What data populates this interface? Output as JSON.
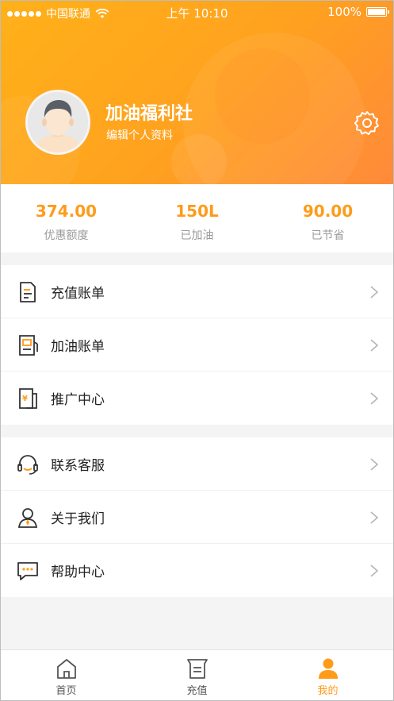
{
  "status_bar": {
    "carrier": "中国联通",
    "time": "上午 10:10",
    "battery": "100%"
  },
  "profile": {
    "name": "加油福利社",
    "edit_label": "编辑个人资料"
  },
  "stats": [
    {
      "value": "374.00",
      "label": "优惠额度"
    },
    {
      "value": "150L",
      "label": "已加油"
    },
    {
      "value": "90.00",
      "label": "已节省"
    }
  ],
  "menu": {
    "group1": [
      {
        "label": "充值账单",
        "icon": "recharge-bill-icon"
      },
      {
        "label": "加油账单",
        "icon": "fuel-bill-icon"
      },
      {
        "label": "推广中心",
        "icon": "promotion-icon"
      }
    ],
    "group2": [
      {
        "label": "联系客服",
        "icon": "headset-icon"
      },
      {
        "label": "关于我们",
        "icon": "person-icon"
      },
      {
        "label": "帮助中心",
        "icon": "chat-icon"
      }
    ]
  },
  "tabbar": [
    {
      "label": "首页",
      "icon": "home-icon"
    },
    {
      "label": "充值",
      "icon": "recharge-icon"
    },
    {
      "label": "我的",
      "icon": "profile-icon",
      "active": true
    }
  ],
  "colors": {
    "accent": "#ff9b1a",
    "header_start": "#ffb119",
    "header_end": "#ff8a3a"
  }
}
